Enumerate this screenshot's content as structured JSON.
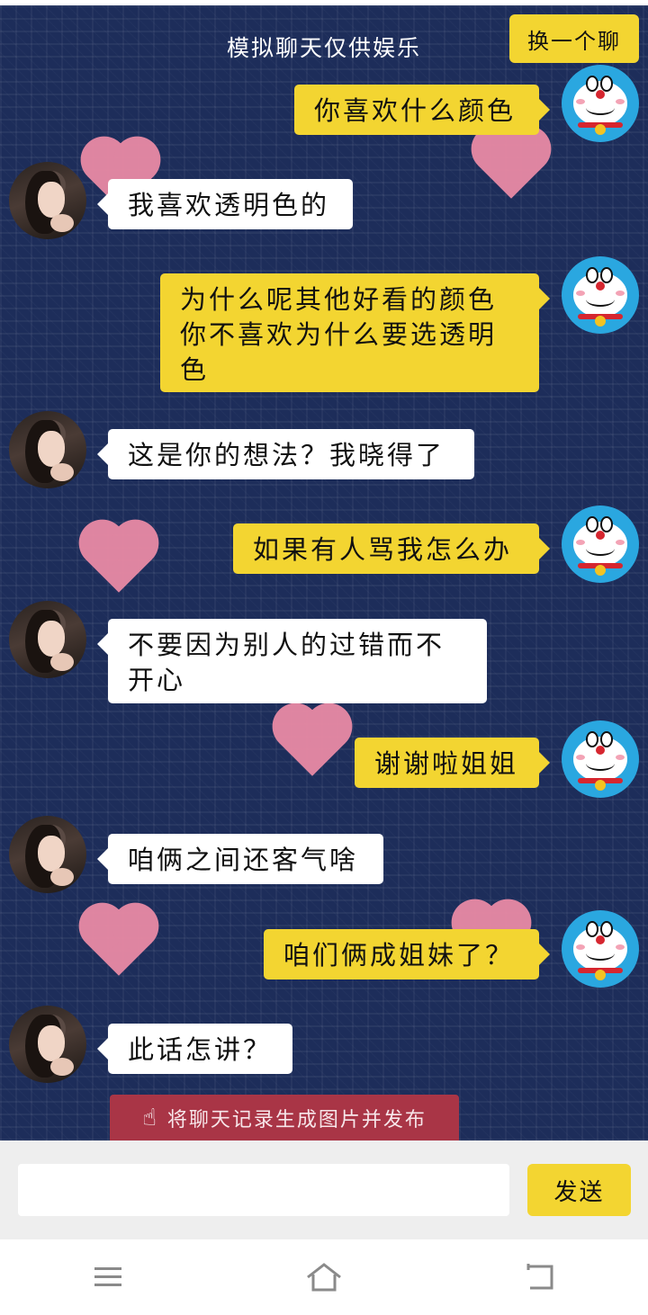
{
  "header": {
    "title": "模拟聊天仅供娱乐",
    "switch_label": "换一个聊"
  },
  "messages": [
    {
      "side": "right",
      "text": "你喜欢什么颜色"
    },
    {
      "side": "left",
      "text": "我喜欢透明色的"
    },
    {
      "side": "right",
      "text": "为什么呢其他好看的颜色你不喜欢为什么要选透明色"
    },
    {
      "side": "left",
      "text": "这是你的想法？我晓得了"
    },
    {
      "side": "right",
      "text": "如果有人骂我怎么办"
    },
    {
      "side": "left",
      "text": "不要因为别人的过错而不开心"
    },
    {
      "side": "right",
      "text": "谢谢啦姐姐"
    },
    {
      "side": "left",
      "text": "咱俩之间还客气啥"
    },
    {
      "side": "right",
      "text": "咱们俩成姐妹了？"
    },
    {
      "side": "left",
      "text": "此话怎讲？"
    }
  ],
  "publish": {
    "label": "将聊天记录生成图片并发布",
    "icon": "pointing-hand-icon"
  },
  "input": {
    "value": "",
    "placeholder": "",
    "send_label": "发送"
  },
  "navigation": {
    "menu_icon": "menu-icon",
    "home_icon": "home-icon",
    "back_icon": "back-icon"
  },
  "colors": {
    "background": "#1d2d5a",
    "accent": "#f3d531",
    "incoming_bubble": "#ffffff",
    "publish_bar": "#a93546",
    "heart": "#e98aa5"
  }
}
